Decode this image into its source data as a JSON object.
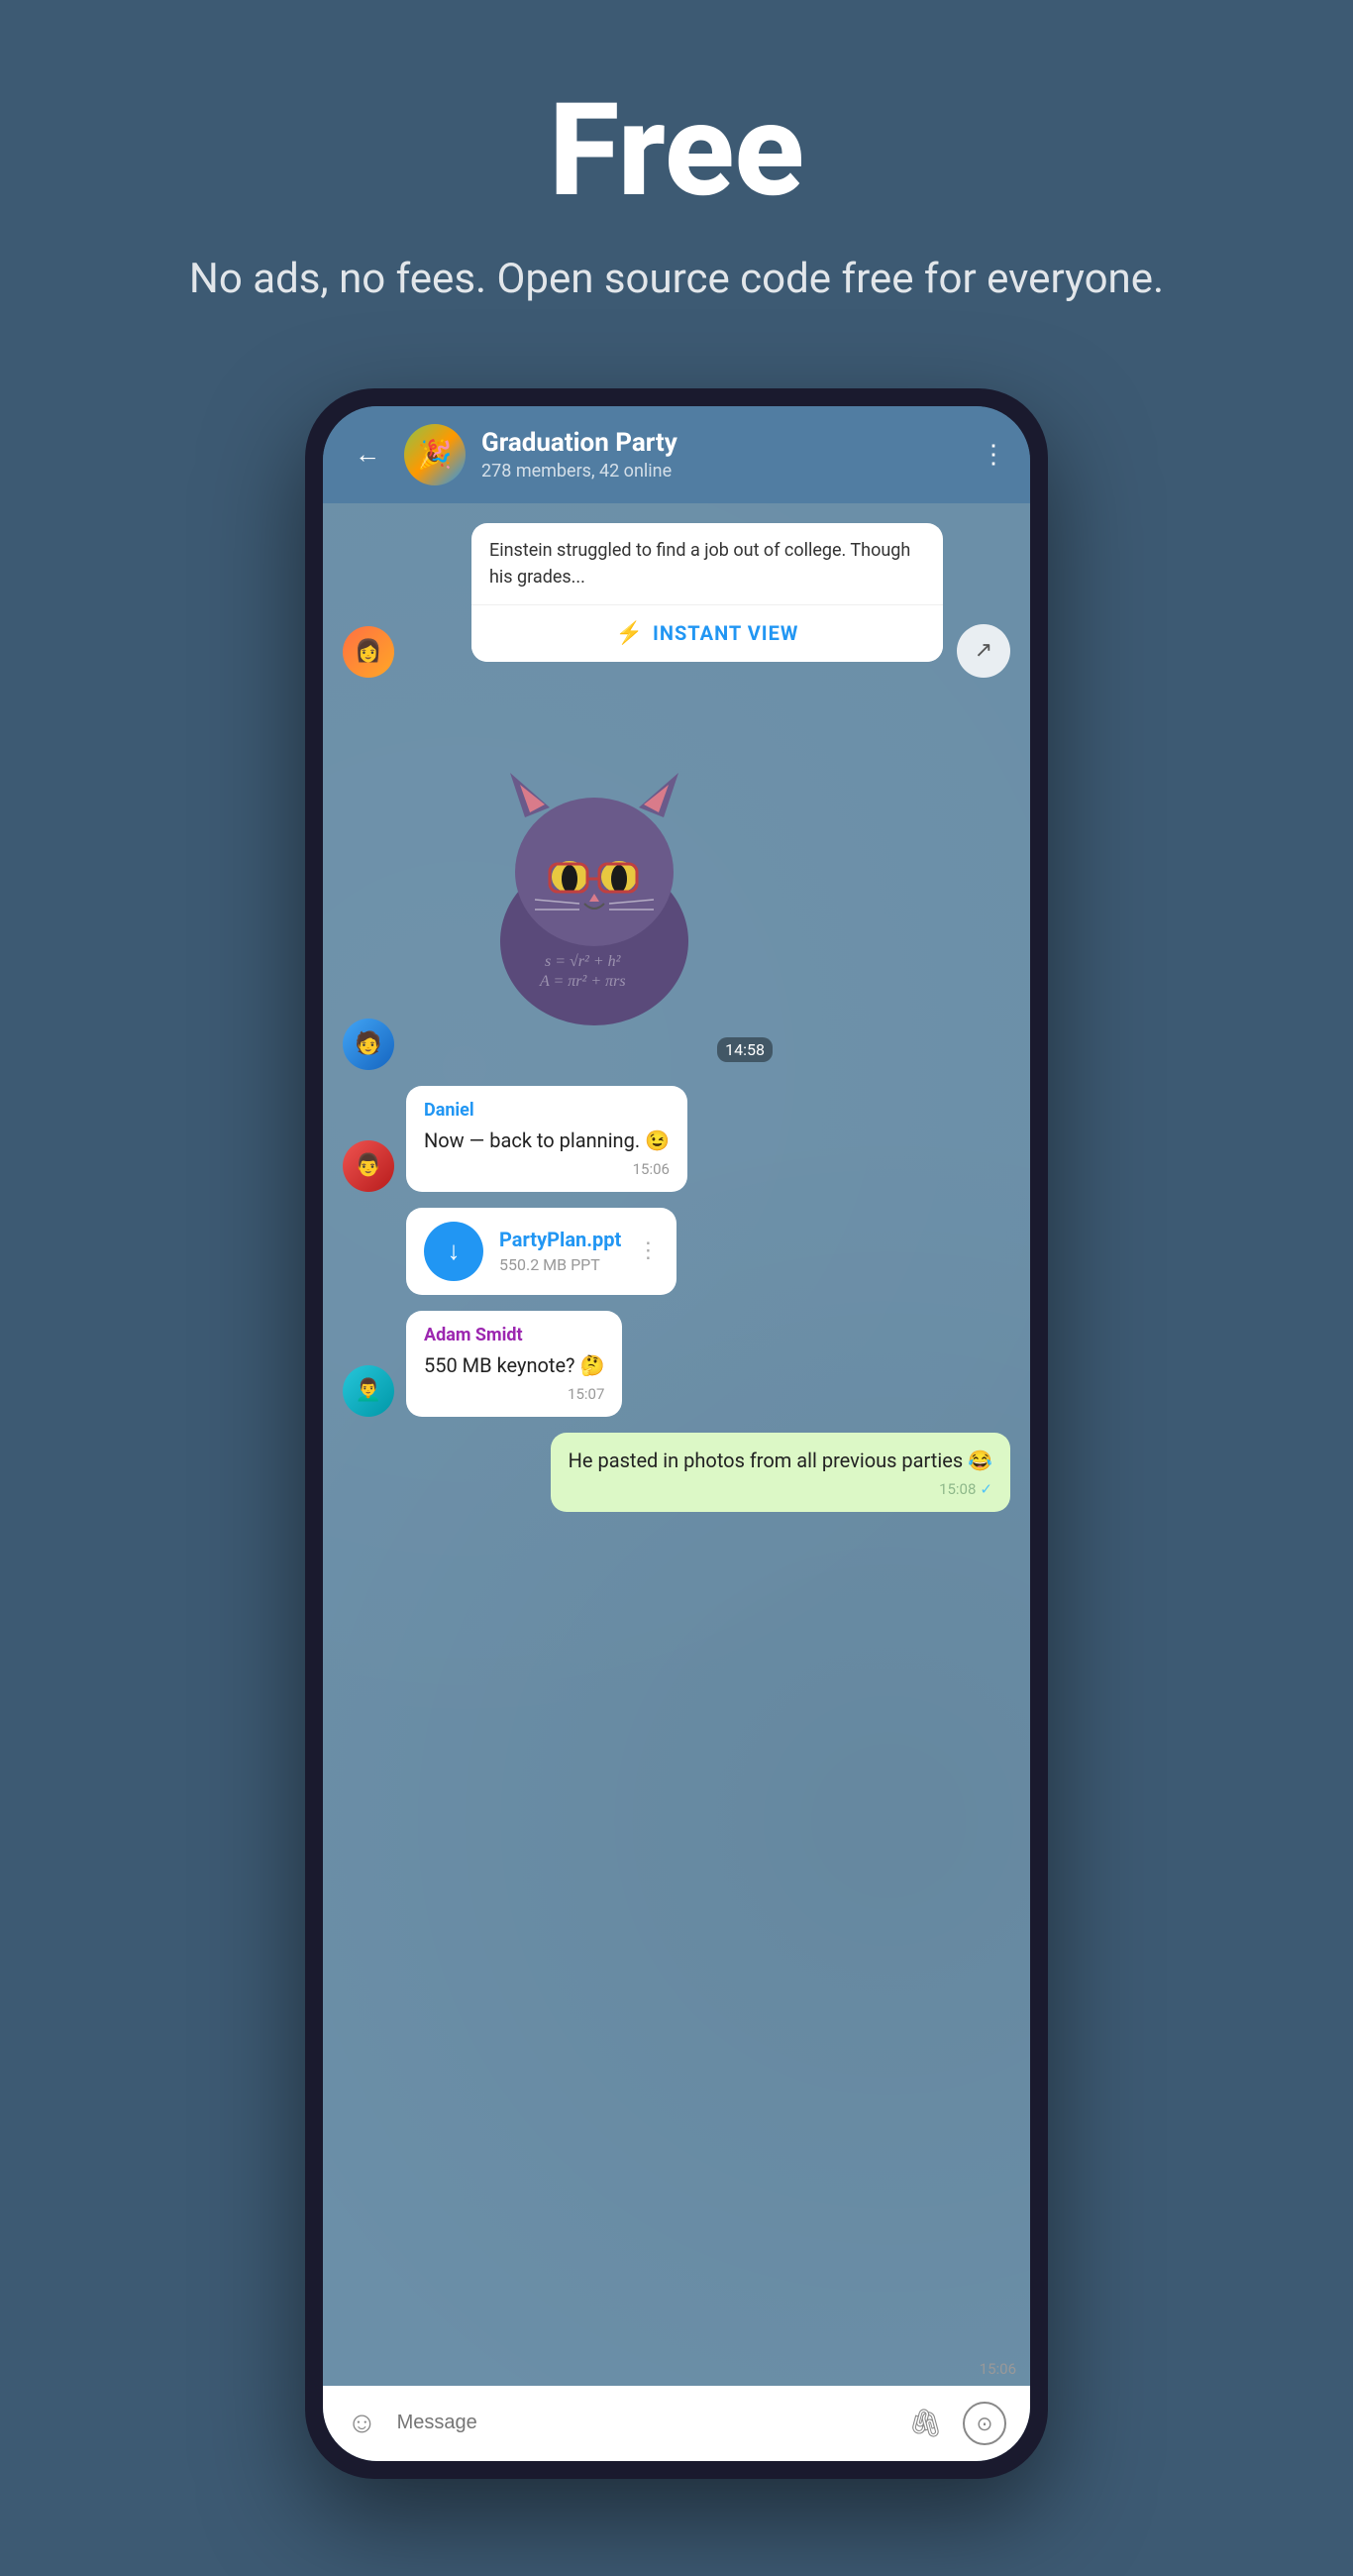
{
  "hero": {
    "title": "Free",
    "subtitle": "No ads, no fees. Open source\ncode free for everyone."
  },
  "chat": {
    "header": {
      "back_label": "←",
      "group_name": "Graduation Party",
      "group_status": "278 members, 42 online",
      "more_icon": "⋮"
    },
    "messages": [
      {
        "id": "iv-card",
        "type": "instant_view",
        "avatar_type": "female",
        "text": "Einstein struggled to find a job out of college. Though his grades...",
        "button_label": "INSTANT VIEW",
        "lightning": "⚡"
      },
      {
        "id": "sticker-msg",
        "type": "sticker",
        "avatar_type": "male1",
        "time": "14:58"
      },
      {
        "id": "daniel-msg",
        "type": "text",
        "sender": "Daniel",
        "sender_color": "blue",
        "avatar_type": "male2",
        "text": "Now — back to planning. 😉",
        "time": "15:06"
      },
      {
        "id": "file-msg",
        "type": "file",
        "avatar_type": "male2",
        "file_name": "PartyPlan.ppt",
        "file_size": "550.2 MB PPT",
        "time": "15:06"
      },
      {
        "id": "adam-msg",
        "type": "text",
        "sender": "Adam Smidt",
        "sender_color": "purple",
        "avatar_type": "male3",
        "text": "550 MB keynote? 🤔",
        "time": "15:07"
      },
      {
        "id": "sent-msg",
        "type": "sent",
        "text": "He pasted in photos from all previous parties 😂",
        "time": "15:08"
      }
    ],
    "input": {
      "placeholder": "Message",
      "emoji_icon": "☺",
      "attach_icon": "📎",
      "camera_icon": "⊙"
    }
  }
}
